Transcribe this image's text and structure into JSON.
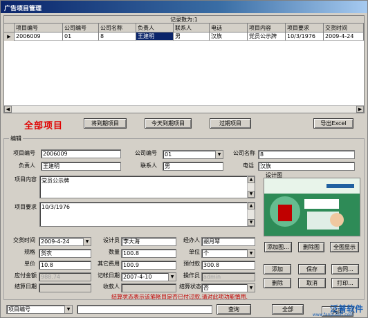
{
  "window": {
    "title": "广告项目管理"
  },
  "grid": {
    "caption": "记录数为:1",
    "row_marker": "▶",
    "columns": [
      "项目编号",
      "公司编号",
      "公司名称",
      "负责人",
      "联系人",
      "电话",
      "项目内容",
      "项目要求",
      "交货时间"
    ],
    "rows": [
      [
        "2006009",
        "01",
        "8",
        "王建明",
        "男",
        "汉族",
        "党员公示牌",
        "10/3/1976",
        "2009-4-24"
      ]
    ],
    "scroll_left": "◀",
    "scroll_right": "▶"
  },
  "heading": "全部项目",
  "toolbar": {
    "expiring": "将到期项目",
    "today_expiring": "今天到期项目",
    "expired": "过期项目",
    "export": "导出Excel"
  },
  "edit": {
    "group_label": "编辑",
    "project_no_label": "项目编号",
    "project_no": "2006009",
    "company_no_label": "公司编号",
    "company_no": "01",
    "company_name_label": "公司名称",
    "company_name": "8",
    "manager_label": "负责人",
    "manager": "王建明",
    "contact_label": "联系人",
    "contact": "男",
    "phone_label": "电话",
    "phone": "汉族",
    "content_label": "项目内容",
    "content": "党员公示牌",
    "requirement_label": "项目要求",
    "requirement": "10/3/1976",
    "delivery_label": "交货时间",
    "delivery": "2009-4-24",
    "designer_label": "设计员",
    "designer": "李大海",
    "handler_label": "经办人",
    "handler": "胡月琴",
    "spec_label": "规格",
    "spec": "货农",
    "qty_label": "数量",
    "qty": "100.8",
    "unit_label": "单位",
    "unit": "个",
    "price_label": "单价",
    "price": "10.8",
    "other_fee_label": "其它费用",
    "other_fee": "100.9",
    "prepay_label": "预付款",
    "prepay": "300.8",
    "payable_label": "应付金额",
    "payable": "988.74",
    "bill_date_label": "记帐日期",
    "bill_date": "2007-4-10",
    "operator_label": "操作员",
    "operator": "admin",
    "settle_date_label": "结算日期",
    "settle_date": "",
    "receiver_label": "收款人",
    "receiver": "",
    "settle_status_label": "结算状态",
    "settle_status": "否"
  },
  "design": {
    "label": "设计图",
    "add": "添加图...",
    "delete": "删除图",
    "fullview": "全图显示"
  },
  "actions": {
    "add": "添加",
    "save": "保存",
    "contract": "合同...",
    "delete": "删除",
    "cancel": "取消",
    "print": "打印..."
  },
  "status_text": "结算状态表示该笔帐目是否已付过款,请对此项功能慎用.",
  "search": {
    "field": "项目编号",
    "value": "",
    "query": "查询",
    "all": "全部",
    "close": "关闭"
  },
  "watermark": {
    "text": "泛普软件",
    "sub": "www.fanpusoft.com"
  },
  "colors": {
    "heading": "#e00000",
    "title_bar": "#0a246a",
    "status": "#c00000"
  }
}
